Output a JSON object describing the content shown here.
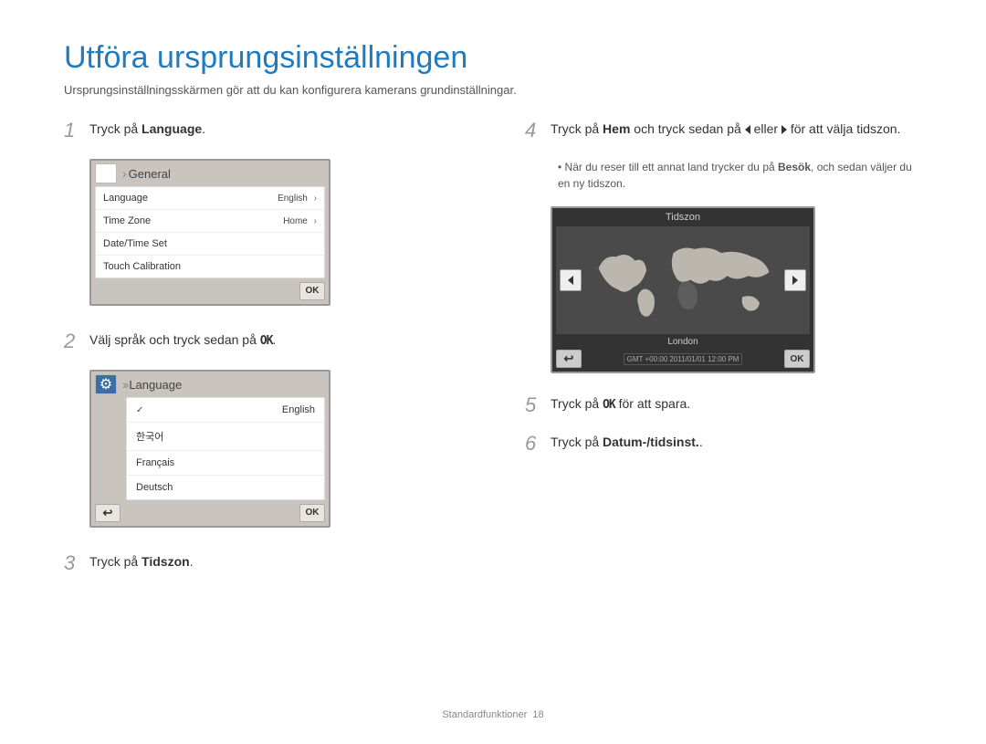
{
  "title": "Utföra ursprungsinställningen",
  "intro": "Ursprungsinställningsskärmen gör att du kan konfigurera kamerans grundinställningar.",
  "steps": {
    "s1": {
      "num": "1",
      "pre": "Tryck på ",
      "bold": "Language",
      "post": "."
    },
    "s2": {
      "num": "2",
      "pre": "Välj språk och tryck sedan på ",
      "ok": "OK",
      "post": "."
    },
    "s3": {
      "num": "3",
      "pre": "Tryck på ",
      "bold": "Tidszon",
      "post": "."
    },
    "s4": {
      "num": "4",
      "pre": "Tryck på ",
      "bold": "Hem",
      "mid1": " och tryck sedan på ",
      "mid2": " eller ",
      "post": " för att välja tidszon."
    },
    "s4_sub": {
      "pre": "När du reser till ett annat land trycker du på ",
      "bold": "Besök",
      "post": ", och sedan väljer du en ny tidszon."
    },
    "s5": {
      "num": "5",
      "pre": "Tryck på ",
      "ok": "OK",
      "post": " för att spara."
    },
    "s6": {
      "num": "6",
      "pre": "Tryck på ",
      "bold": "Datum-/tidsinst.",
      "post": "."
    }
  },
  "screen_general": {
    "header": "General",
    "rows": [
      {
        "label": "Language",
        "value": "English"
      },
      {
        "label": "Time Zone",
        "value": "Home"
      },
      {
        "label": "Date/Time Set",
        "value": ""
      },
      {
        "label": "Touch Calibration",
        "value": ""
      }
    ],
    "ok": "OK"
  },
  "screen_language": {
    "header": "Language",
    "items": [
      "English",
      "한국어",
      "Français",
      "Deutsch"
    ],
    "ok": "OK"
  },
  "screen_timezone": {
    "title": "Tidszon",
    "city": "London",
    "info": "GMT +00:00   2011/01/01  12:00 PM",
    "ok": "OK"
  },
  "footer": {
    "section": "Standardfunktioner",
    "page": "18"
  }
}
